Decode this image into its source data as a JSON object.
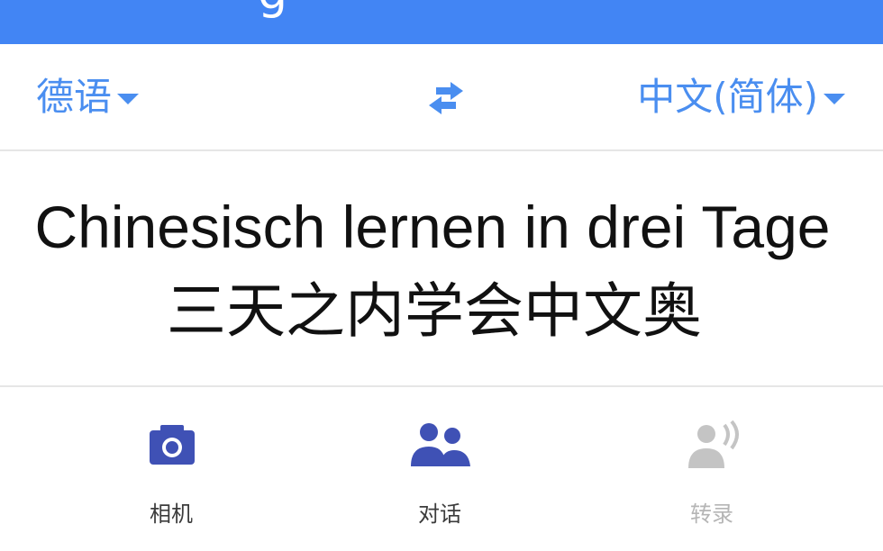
{
  "app_bar": {
    "title_fragment": "g",
    "color": "#4285f4"
  },
  "languages": {
    "source": "德语",
    "target": "中文(简体)",
    "swap_icon": "swap-arrows-icon",
    "accent_color": "#4a8ef0"
  },
  "translation": {
    "source_text": "Chinesisch lernen in drei Tage",
    "result_text": "三天之内学会中文奥"
  },
  "tools": [
    {
      "label": "相机",
      "icon": "camera-icon",
      "color": "#3f51b5",
      "enabled": true
    },
    {
      "label": "对话",
      "icon": "conversation-icon",
      "color": "#3f51b5",
      "enabled": true
    },
    {
      "label": "转录",
      "icon": "transcribe-icon",
      "color": "#c4c4c4",
      "enabled": false
    }
  ]
}
